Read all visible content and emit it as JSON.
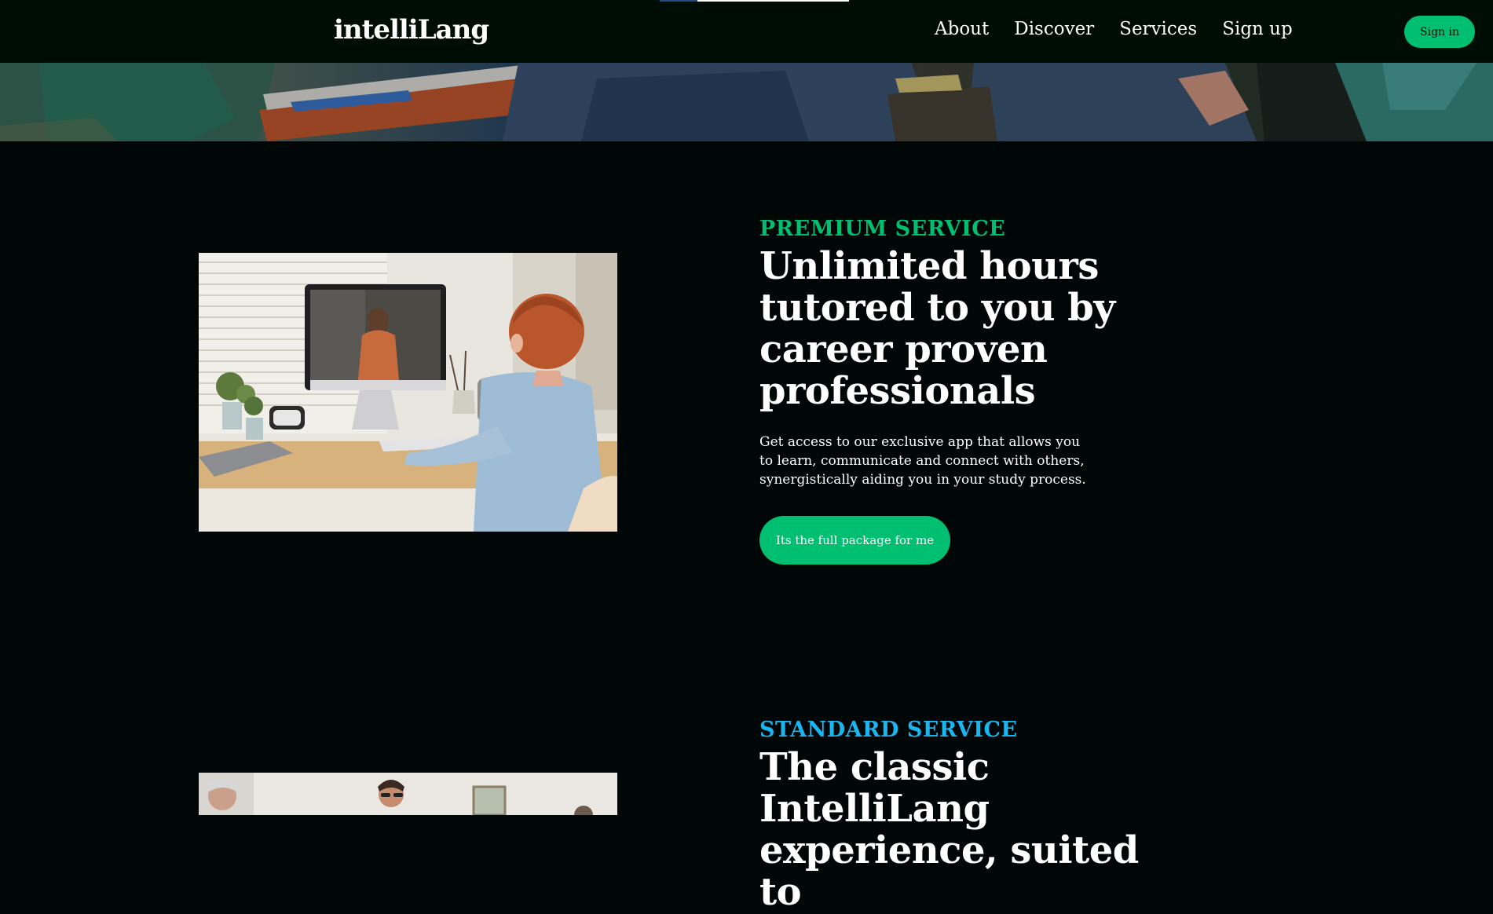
{
  "navbar": {
    "logo": "intelliLang",
    "items": [
      {
        "label": "About"
      },
      {
        "label": "Discover"
      },
      {
        "label": "Services"
      },
      {
        "label": "Sign up"
      }
    ],
    "signin_label": "Sign in"
  },
  "sections": [
    {
      "topline": "PREMIUM SERVICE",
      "topline_color": "#01bf71",
      "headline": "Unlimited hours tutored to you by career proven professionals",
      "subtitle": "Get access to our exclusive app that allows you to learn, communicate and connect with others, synergistically aiding you in your study process.",
      "button_label": "Its the full package for me"
    },
    {
      "topline": "STANDARD SERVICE",
      "topline_color": "#1bb6ef",
      "headline": "The classic IntelliLang experience, suited to"
    }
  ],
  "colors": {
    "background": "#010606",
    "navbar": "#000d04",
    "accent": "#01bf71"
  }
}
